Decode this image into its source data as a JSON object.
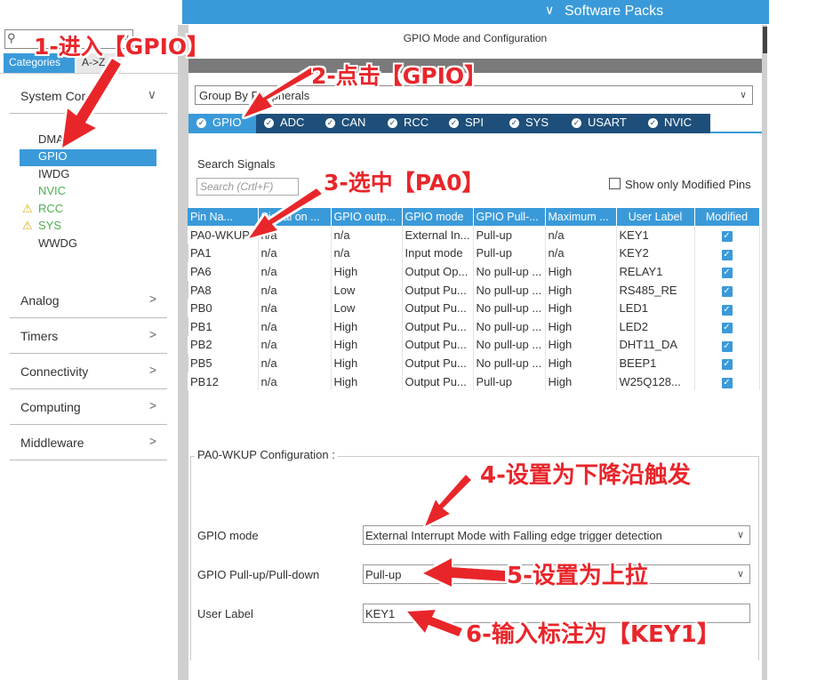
{
  "header": {
    "software_packs": "Software Packs"
  },
  "left_panel": {
    "search_placeholder": "",
    "tabs": [
      "Categories",
      "A->Z"
    ],
    "system_core": {
      "title": "System Core",
      "items": [
        {
          "label": "DMA",
          "state": "normal"
        },
        {
          "label": "GPIO",
          "state": "selected"
        },
        {
          "label": "IWDG",
          "state": "normal"
        },
        {
          "label": "NVIC",
          "state": "green"
        },
        {
          "label": "RCC",
          "state": "warning"
        },
        {
          "label": "SYS",
          "state": "warning"
        },
        {
          "label": "WWDG",
          "state": "normal"
        }
      ]
    },
    "sections": [
      "Analog",
      "Timers",
      "Connectivity",
      "Computing",
      "Middleware"
    ]
  },
  "main": {
    "title": "GPIO Mode and Configuration",
    "group_by": "Group By Peripherals",
    "tabs": [
      "GPIO",
      "ADC",
      "CAN",
      "RCC",
      "SPI",
      "SYS",
      "USART",
      "NVIC"
    ],
    "search_signals_label": "Search Signals",
    "search_signals_placeholder": "Search (Crtl+F)",
    "show_modified_label": "Show only Modified Pins",
    "table": {
      "headers": [
        "Pin Na...",
        "Signal on ...",
        "GPIO outp...",
        "GPIO mode",
        "GPIO Pull-...",
        "Maximum ...",
        "User Label",
        "Modified"
      ],
      "rows": [
        [
          "PA0-WKUP",
          "n/a",
          "n/a",
          "External In...",
          "Pull-up",
          "n/a",
          "KEY1"
        ],
        [
          "PA1",
          "n/a",
          "n/a",
          "Input mode",
          "Pull-up",
          "n/a",
          "KEY2"
        ],
        [
          "PA6",
          "n/a",
          "High",
          "Output Op...",
          "No pull-up ...",
          "High",
          "RELAY1"
        ],
        [
          "PA8",
          "n/a",
          "Low",
          "Output Pu...",
          "No pull-up ...",
          "High",
          "RS485_RE"
        ],
        [
          "PB0",
          "n/a",
          "Low",
          "Output Pu...",
          "No pull-up ...",
          "High",
          "LED1"
        ],
        [
          "PB1",
          "n/a",
          "High",
          "Output Pu...",
          "No pull-up ...",
          "High",
          "LED2"
        ],
        [
          "PB2",
          "n/a",
          "High",
          "Output Pu...",
          "No pull-up ...",
          "High",
          "DHT11_DA"
        ],
        [
          "PB5",
          "n/a",
          "High",
          "Output Pu...",
          "No pull-up ...",
          "High",
          "BEEP1"
        ],
        [
          "PB12",
          "n/a",
          "High",
          "Output Pu...",
          "Pull-up",
          "High",
          "W25Q128..."
        ]
      ]
    },
    "config": {
      "title": "PA0-WKUP Configuration :",
      "gpio_mode_label": "GPIO mode",
      "gpio_mode_value": "External Interrupt Mode with Falling edge trigger detection",
      "pull_label": "GPIO Pull-up/Pull-down",
      "pull_value": "Pull-up",
      "user_label_label": "User Label",
      "user_label_value": "KEY1"
    }
  },
  "annotations": [
    "1-进入【GPIO】",
    "2-点击【GPIO】",
    "3-选中【PA0】",
    "4-设置为下降沿触发",
    "5-设置为上拉",
    "6-输入标注为【KEY1】"
  ],
  "colors": {
    "accent": "#3a9ad9",
    "tab_dark": "#1e4f7a",
    "annotation": "#e8262b",
    "warning": "#e5b100",
    "ok_green": "#4caf50"
  }
}
